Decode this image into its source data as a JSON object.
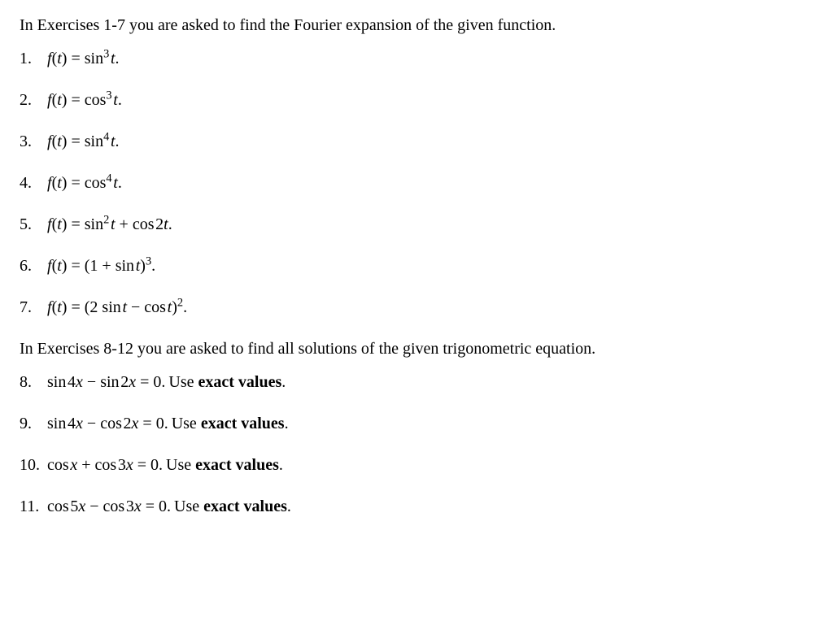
{
  "intro1": "In Exercises 1-7 you are asked to find the Fourier expansion of the given function.",
  "intro2": "In Exercises 8-12 you are asked to find all solutions of the given trigonometric equation.",
  "use_exact": "exact values",
  "use_prefix": " Use ",
  "use_suffix": ".",
  "ex": {
    "1": {
      "n": "1.",
      "lhs": "f",
      "arg": "t",
      "rhs_a": "sin",
      "rhs_exp": "3",
      "rhs_b": "t"
    },
    "2": {
      "n": "2.",
      "lhs": "f",
      "arg": "t",
      "rhs_a": "cos",
      "rhs_exp": "3",
      "rhs_b": "t"
    },
    "3": {
      "n": "3.",
      "lhs": "f",
      "arg": "t",
      "rhs_a": "sin",
      "rhs_exp": "4",
      "rhs_b": "t"
    },
    "4": {
      "n": "4.",
      "lhs": "f",
      "arg": "t",
      "rhs_a": "cos",
      "rhs_exp": "4",
      "rhs_b": "t"
    },
    "5": {
      "n": "5.",
      "lhs": "f",
      "arg": "t",
      "t1_fn": "sin",
      "t1_exp": "2",
      "t1_var": "t",
      "plus": " + ",
      "t2_fn": "cos",
      "t2_arg": "2t"
    },
    "6": {
      "n": "6.",
      "lhs": "f",
      "arg": "t",
      "open": "(1 + ",
      "fn": "sin",
      "var": "t",
      "close": ")",
      "exp": "3"
    },
    "7": {
      "n": "7.",
      "lhs": "f",
      "arg": "t",
      "open": "(2",
      "sp": " ",
      "fn1": "sin",
      "var1": "t",
      "minus": " − ",
      "fn2": "cos",
      "var2": "t",
      "close": ")",
      "exp": "2"
    },
    "8": {
      "n": "8.",
      "t1_fn": "sin",
      "t1_arg": "4x",
      "op": " − ",
      "t2_fn": "sin",
      "t2_arg": "2x",
      "eq": " = 0."
    },
    "9": {
      "n": "9.",
      "t1_fn": "sin",
      "t1_arg": "4x",
      "op": " − ",
      "t2_fn": "cos",
      "t2_arg": "2x",
      "eq": " = 0."
    },
    "10": {
      "n": "10.",
      "t1_fn": "cos",
      "t1_arg": "x",
      "op": " + ",
      "t2_fn": "cos",
      "t2_arg": "3x",
      "eq": " = 0."
    },
    "11": {
      "n": "11.",
      "t1_fn": "cos",
      "t1_arg": "5x",
      "op": " − ",
      "t2_fn": "cos",
      "t2_arg": "3x",
      "eq": " = 0."
    }
  }
}
